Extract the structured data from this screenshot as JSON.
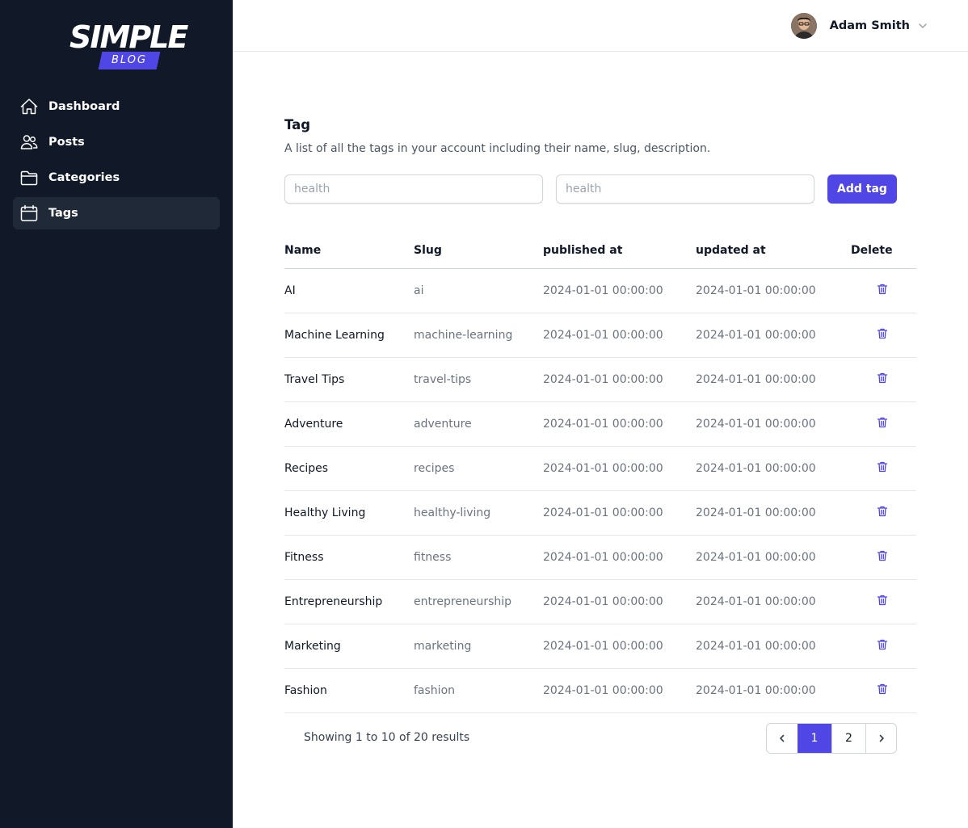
{
  "brand": {
    "line1": "SIMPLE",
    "line2": "BLOG",
    "accent": "#4f46e5"
  },
  "sidebar": {
    "items": [
      {
        "label": "Dashboard",
        "icon": "home-icon"
      },
      {
        "label": "Posts",
        "icon": "users-icon"
      },
      {
        "label": "Categories",
        "icon": "folder-icon"
      },
      {
        "label": "Tags",
        "icon": "calendar-icon",
        "active": true
      }
    ]
  },
  "user": {
    "name": "Adam Smith"
  },
  "page": {
    "title": "Tag",
    "subtitle": "A list of all the tags in your account including their name, slug, description."
  },
  "form": {
    "name_placeholder": "health",
    "slug_placeholder": "health",
    "add_label": "Add tag"
  },
  "table": {
    "headers": [
      "Name",
      "Slug",
      "published at",
      "updated at",
      "Delete"
    ],
    "rows": [
      {
        "name": "AI",
        "slug": "ai",
        "published": "2024-01-01 00:00:00",
        "updated": "2024-01-01 00:00:00"
      },
      {
        "name": "Machine Learning",
        "slug": "machine-learning",
        "published": "2024-01-01 00:00:00",
        "updated": "2024-01-01 00:00:00"
      },
      {
        "name": "Travel Tips",
        "slug": "travel-tips",
        "published": "2024-01-01 00:00:00",
        "updated": "2024-01-01 00:00:00"
      },
      {
        "name": "Adventure",
        "slug": "adventure",
        "published": "2024-01-01 00:00:00",
        "updated": "2024-01-01 00:00:00"
      },
      {
        "name": "Recipes",
        "slug": "recipes",
        "published": "2024-01-01 00:00:00",
        "updated": "2024-01-01 00:00:00"
      },
      {
        "name": "Healthy Living",
        "slug": "healthy-living",
        "published": "2024-01-01 00:00:00",
        "updated": "2024-01-01 00:00:00"
      },
      {
        "name": "Fitness",
        "slug": "fitness",
        "published": "2024-01-01 00:00:00",
        "updated": "2024-01-01 00:00:00"
      },
      {
        "name": "Entrepreneurship",
        "slug": "entrepreneurship",
        "published": "2024-01-01 00:00:00",
        "updated": "2024-01-01 00:00:00"
      },
      {
        "name": "Marketing",
        "slug": "marketing",
        "published": "2024-01-01 00:00:00",
        "updated": "2024-01-01 00:00:00"
      },
      {
        "name": "Fashion",
        "slug": "fashion",
        "published": "2024-01-01 00:00:00",
        "updated": "2024-01-01 00:00:00"
      }
    ]
  },
  "pagination": {
    "summary": "Showing 1 to 10 of 20 results",
    "pages": [
      "1",
      "2"
    ],
    "current": "1"
  }
}
